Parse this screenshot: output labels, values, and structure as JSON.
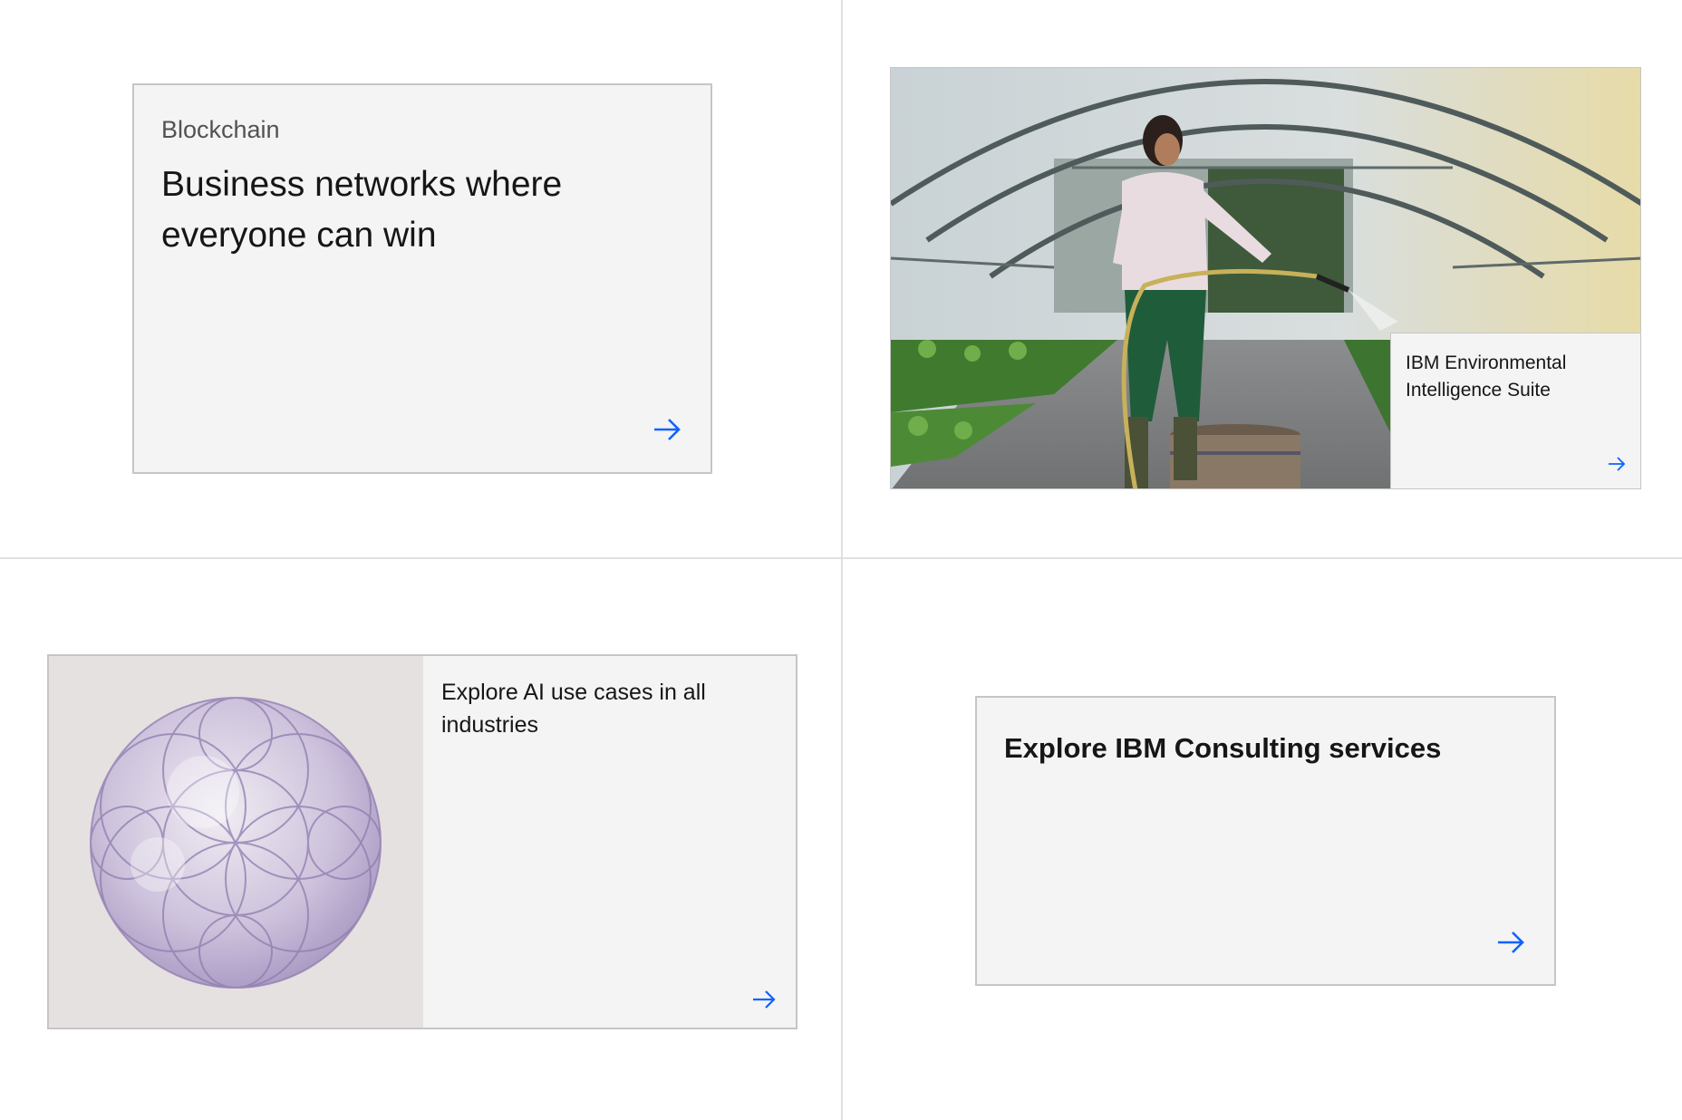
{
  "cards": [
    {
      "eyebrow": "Blockchain",
      "heading": "Business networks where everyone can win",
      "link_icon": "arrow-right-icon"
    },
    {
      "image": "greenhouse-photo",
      "heading": "IBM Environmental Intelligence Suite",
      "link_icon": "arrow-right-icon"
    },
    {
      "image": "ai-abstract-circles",
      "heading": "Explore AI use cases in all industries",
      "link_icon": "arrow-right-icon"
    },
    {
      "heading": "Explore IBM Consulting services",
      "link_icon": "arrow-right-icon"
    }
  ],
  "colors": {
    "link": "#0f62fe",
    "card_bg": "#f4f4f4",
    "border": "#c6c6c6",
    "divider": "#e0e0e0"
  }
}
